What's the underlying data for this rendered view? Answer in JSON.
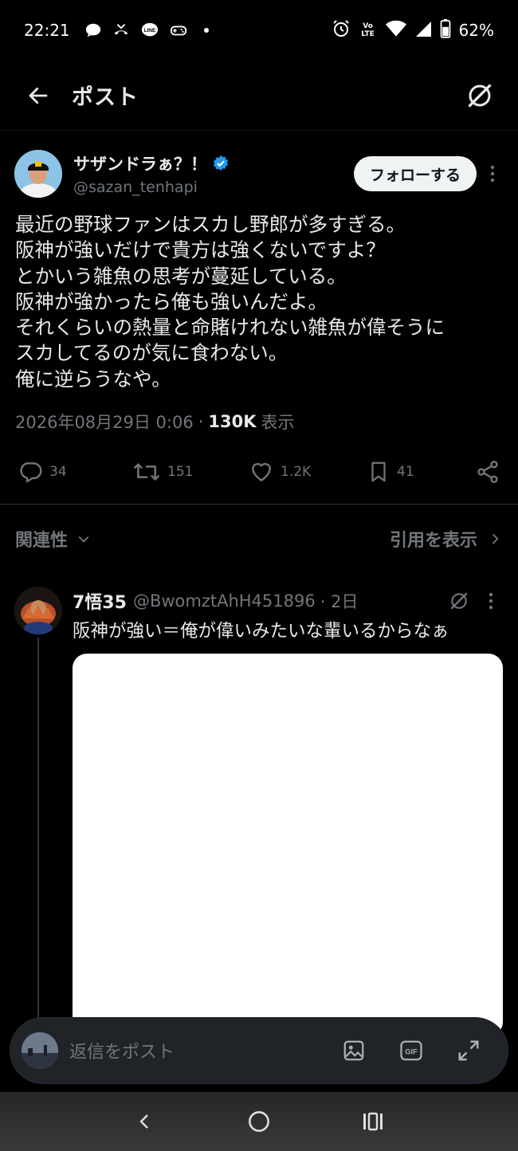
{
  "status_bar": {
    "time": "22:21",
    "battery": "62%",
    "network_label": "Vo LTE"
  },
  "header": {
    "title": "ポスト"
  },
  "post": {
    "author": {
      "display_name": "サザンドラぁ？！",
      "handle": "@sazan_tenhapi",
      "verified": true
    },
    "follow_label": "フォローする",
    "lines": [
      "最近の野球ファンはスカし野郎が多すぎる。",
      "阪神が強いだけで貴方は強くないですよ？",
      "とかいう雑魚の思考が蔓延している。",
      "阪神が強かったら俺も強いんだよ。",
      "それくらいの熱量と命賭けれない雑魚が偉そうに",
      "スカしてるのが気に食わない。",
      "俺に逆らうなや。"
    ],
    "timestamp": "2026年08月29日 0:06",
    "views_count": "130K",
    "views_label": "表示",
    "stats": {
      "replies": "34",
      "reposts": "151",
      "likes": "1.2K",
      "bookmarks": "41"
    }
  },
  "sort": {
    "left_label": "関連性",
    "right_label": "引用を表示"
  },
  "reply": {
    "display_name": "7悟35",
    "handle": "@BwomztAhH451896",
    "time": "· 2日",
    "text": "阪神が強い＝俺が偉いみたいな輩いるからなぁ"
  },
  "composer": {
    "placeholder": "返信をポスト",
    "gif_label": "GIF"
  },
  "colors": {
    "background": "#000000",
    "text": "#e7e9ea",
    "muted": "#71767b",
    "verified": "#1d9bf0",
    "follow_bg": "#eff3f4"
  }
}
